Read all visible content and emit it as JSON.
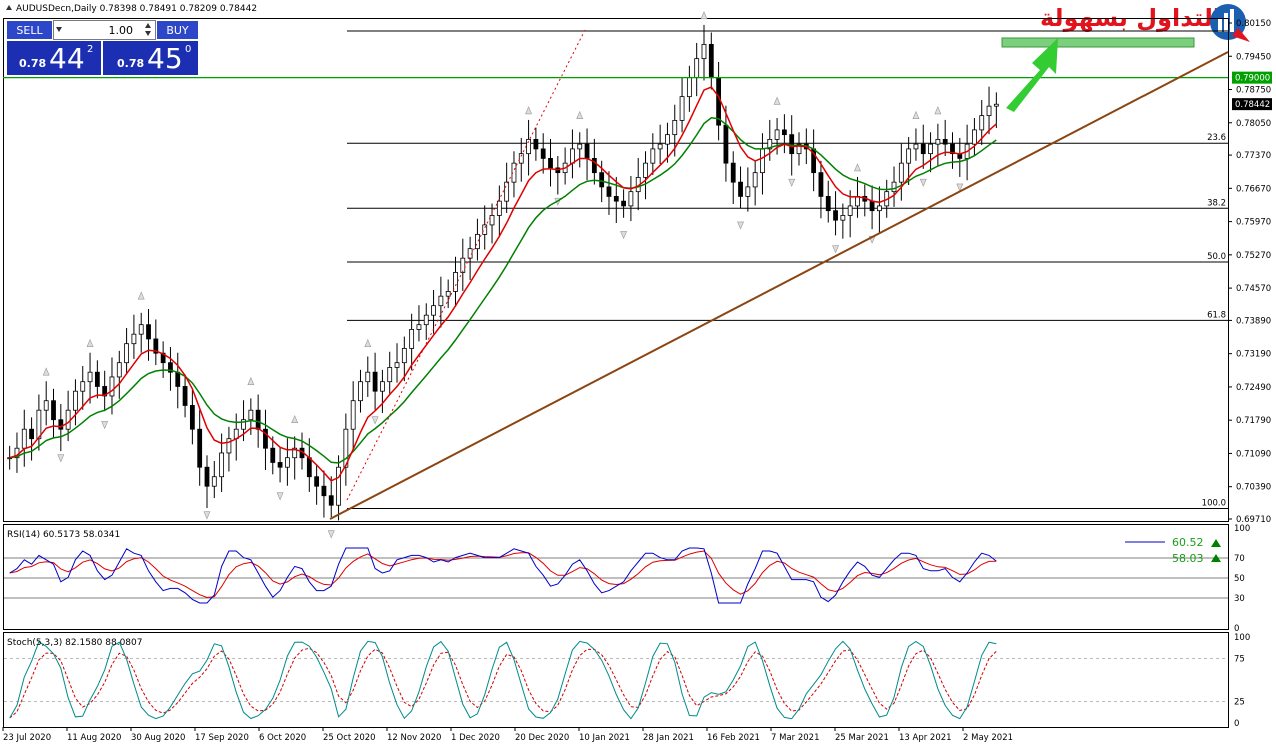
{
  "header": {
    "symbol_line": "AUDUSDecn,Daily  0.78398 0.78491 0.78209 0.78442"
  },
  "trade_panel": {
    "sell_label": "SELL",
    "buy_label": "BUY",
    "lot_value": "1.00",
    "sell_price_prefix": "0.78",
    "sell_price_big": "44",
    "sell_price_sup": "2",
    "buy_price_prefix": "0.78",
    "buy_price_big": "45",
    "buy_price_sup": "0"
  },
  "logo": {
    "text": "التداول بسهولة",
    "colors": {
      "red": "#e2131d",
      "blue": "#1a5fb0"
    }
  },
  "price_axis": {
    "ticks": [
      "0.80150",
      "0.79450",
      "0.78750",
      "0.78050",
      "0.77370",
      "0.76670",
      "0.75970",
      "0.75270",
      "0.74570",
      "0.73890",
      "0.73190",
      "0.72490",
      "0.71790",
      "0.71090",
      "0.70390",
      "0.69710"
    ],
    "highlight_level": "0.79000",
    "current_price": "0.78442",
    "highlight_color": "#00a000"
  },
  "fib_levels": [
    {
      "label": "23.6",
      "price": 0.7762
    },
    {
      "label": "38.2",
      "price": 0.7625
    },
    {
      "label": "50.0",
      "price": 0.7512
    },
    {
      "label": "61.8",
      "price": 0.7389
    },
    {
      "label": "100.0",
      "price": 0.6993
    }
  ],
  "x_axis": {
    "labels": [
      "23 Jul 2020",
      "11 Aug 2020",
      "30 Aug 2020",
      "17 Sep 2020",
      "6 Oct 2020",
      "25 Oct 2020",
      "12 Nov 2020",
      "1 Dec 2020",
      "20 Dec 2020",
      "10 Jan 2021",
      "28 Jan 2021",
      "16 Feb 2021",
      "7 Mar 2021",
      "25 Mar 2021",
      "13 Apr 2021",
      "2 May 2021"
    ]
  },
  "rsi": {
    "title": "RSI(14) 60.5173 58.0341",
    "value_main": "60.52",
    "value_signal": "58.03",
    "levels": [
      "100",
      "70",
      "50",
      "30",
      "0"
    ],
    "colors": {
      "main": "#0000c8",
      "signal": "#e00000",
      "up_arrow": "#008000"
    }
  },
  "stoch": {
    "title": "Stoch(5,3,3) 82.1580 88.0807",
    "levels": [
      "100",
      "75",
      "25",
      "0"
    ],
    "colors": {
      "main": "#008b8b",
      "signal": "#d00000"
    }
  },
  "chart_data": {
    "type": "candlestick",
    "title": "AUDUSDecn,Daily",
    "ohlc_last": {
      "open": 0.78398,
      "high": 0.78491,
      "low": 0.78209,
      "close": 0.78442
    },
    "ylim": [
      0.6971,
      0.8015
    ],
    "price_series_closes": [
      0.71,
      0.712,
      0.716,
      0.714,
      0.72,
      0.722,
      0.718,
      0.716,
      0.72,
      0.724,
      0.726,
      0.728,
      0.725,
      0.723,
      0.727,
      0.73,
      0.734,
      0.736,
      0.738,
      0.735,
      0.732,
      0.73,
      0.728,
      0.725,
      0.721,
      0.716,
      0.708,
      0.704,
      0.706,
      0.711,
      0.714,
      0.716,
      0.718,
      0.72,
      0.716,
      0.712,
      0.709,
      0.708,
      0.71,
      0.712,
      0.71,
      0.706,
      0.704,
      0.702,
      0.7,
      0.708,
      0.716,
      0.722,
      0.726,
      0.728,
      0.724,
      0.726,
      0.729,
      0.73,
      0.733,
      0.737,
      0.738,
      0.74,
      0.742,
      0.744,
      0.745,
      0.749,
      0.752,
      0.754,
      0.757,
      0.759,
      0.761,
      0.764,
      0.768,
      0.772,
      0.774,
      0.777,
      0.775,
      0.773,
      0.771,
      0.77,
      0.772,
      0.775,
      0.776,
      0.773,
      0.77,
      0.767,
      0.765,
      0.764,
      0.763,
      0.766,
      0.769,
      0.772,
      0.775,
      0.776,
      0.778,
      0.781,
      0.786,
      0.79,
      0.794,
      0.797,
      0.79,
      0.78,
      0.772,
      0.768,
      0.765,
      0.767,
      0.77,
      0.775,
      0.777,
      0.779,
      0.778,
      0.774,
      0.776,
      0.775,
      0.77,
      0.765,
      0.762,
      0.76,
      0.761,
      0.763,
      0.765,
      0.764,
      0.762,
      0.763,
      0.766,
      0.768,
      0.772,
      0.775,
      0.776,
      0.774,
      0.776,
      0.777,
      0.776,
      0.774,
      0.773,
      0.776,
      0.779,
      0.782,
      0.784,
      0.7844
    ],
    "ema_fast_color": "#e00000",
    "ema_slow_color": "#008000",
    "trendline_color": "#8b4513",
    "resistance_color": "#00a000",
    "target_zone_color": "#7ccf7c",
    "arrow_color": "#33cc33"
  }
}
